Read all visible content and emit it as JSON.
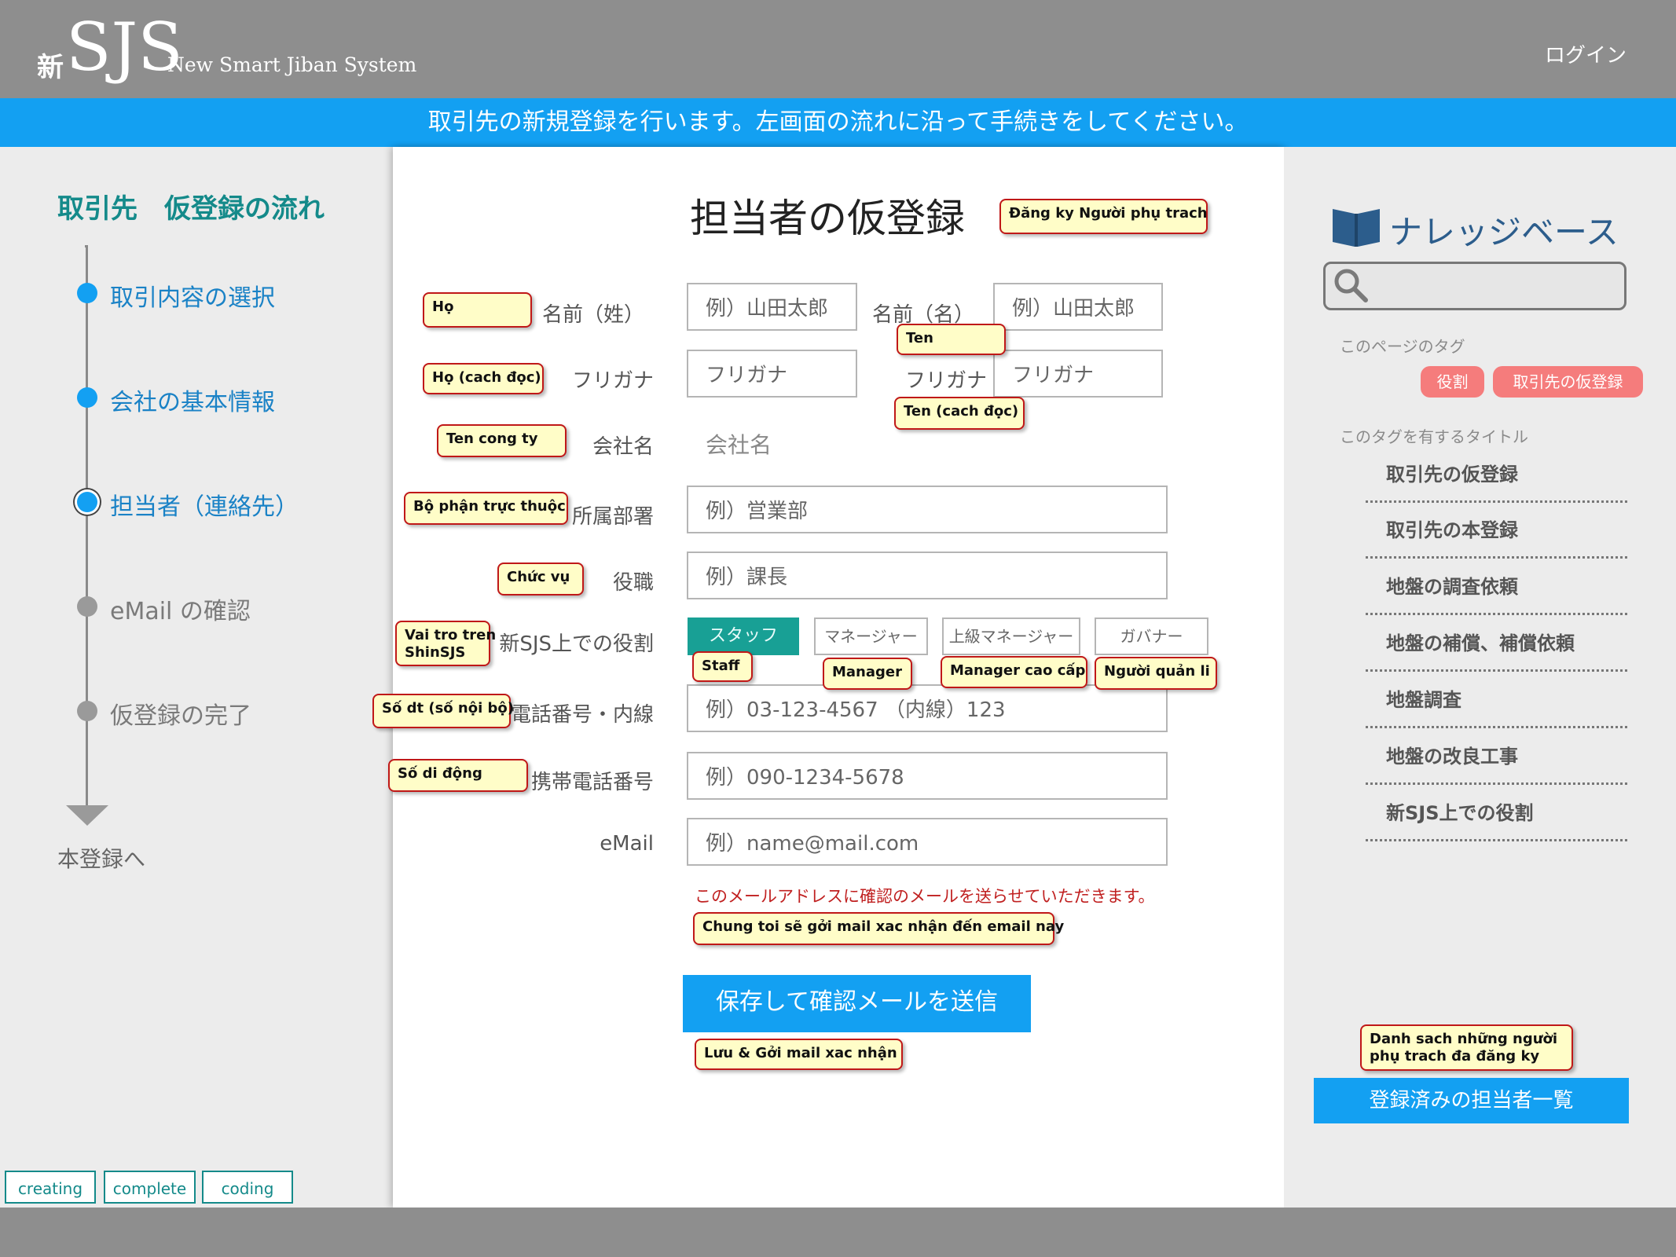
{
  "header": {
    "logo_kanji": "新",
    "logo_text": "SJS",
    "logo_subtitle": "New Smart Jiban System",
    "login_label": "ログイン"
  },
  "banner": {
    "text": "取引先の新規登録を行います。左画面の流れに沿って手続きをしてください。"
  },
  "flow": {
    "title": "取引先　仮登録の流れ",
    "steps": [
      {
        "label": "取引内容の選択",
        "state": "done"
      },
      {
        "label": "会社の基本情報",
        "state": "done"
      },
      {
        "label": "担当者（連絡先）",
        "state": "current"
      },
      {
        "label": "eMail の確認",
        "state": "todo"
      },
      {
        "label": "仮登録の完了",
        "state": "todo"
      }
    ],
    "end_label": "本登録へ"
  },
  "status_buttons": [
    "creating",
    "complete",
    "coding"
  ],
  "form": {
    "title": "担当者の仮登録",
    "last_name_label": "名前（姓）",
    "last_name_placeholder": "例）山田太郎",
    "first_name_label": "名前（名）",
    "first_name_placeholder": "例）山田太郎",
    "last_kana_label": "フリガナ",
    "last_kana_placeholder": "フリガナ",
    "first_kana_label": "フリガナ",
    "first_kana_placeholder": "フリガナ",
    "company_label": "会社名",
    "company_value": "会社名",
    "department_label": "所属部署",
    "department_placeholder": "例）営業部",
    "position_label": "役職",
    "position_placeholder": "例）課長",
    "role_label": "新SJS上での役割",
    "roles": [
      {
        "label": "スタッフ",
        "selected": true
      },
      {
        "label": "マネージャー",
        "selected": false
      },
      {
        "label": "上級マネージャー",
        "selected": false
      },
      {
        "label": "ガバナー",
        "selected": false
      }
    ],
    "phone_label": "電話番号・内線",
    "phone_placeholder": "例）03-123-4567 （内線）123",
    "mobile_label": "携帯電話番号",
    "mobile_placeholder": "例）090-1234-5678",
    "email_label": "eMail",
    "email_placeholder": "例）name@mail.com",
    "email_note": "このメールアドレスに確認のメールを送らせていただきます。",
    "submit_label": "保存して確認メールを送信"
  },
  "notes": {
    "title": "Đăng ky Người phụ trach",
    "last_name": "Họ",
    "last_kana": "Họ (cach đọc)",
    "first_name": "Ten",
    "first_kana": "Ten (cach đọc)",
    "company": "Ten cong ty",
    "department": "Bộ phận trực thuộc",
    "position": "Chức vụ",
    "role_line1": "Vai tro tren",
    "role_line2": "ShinSJS",
    "staff": "Staff",
    "manager": "Manager",
    "senior_manager": "Manager cao cấp",
    "governor": "Người quản li",
    "phone": "Số dt (số nội bộ)",
    "mobile": "Số di động",
    "email_note": "Chung toi sẽ gởi mail xac nhận đến email nay",
    "submit": "Lưu & Gởi mail xac nhận",
    "list_line1": "Danh sach những người",
    "list_line2": "phụ trach đa đăng ky"
  },
  "knowledge": {
    "title": "ナレッジベース",
    "search_placeholder": "",
    "tags_heading": "このページのタグ",
    "tags": [
      "役割",
      "取引先の仮登録"
    ],
    "titles_heading": "このタグを有するタイトル",
    "links": [
      "取引先の仮登録",
      "取引先の本登録",
      "地盤の調査依頼",
      "地盤の補償、補償依頼",
      "地盤調査",
      "地盤の改良工事",
      "新SJS上での役割"
    ],
    "list_button": "登録済みの担当者一覧"
  },
  "colors": {
    "accent": "#13a0f2",
    "teal": "#148a8a",
    "staff_selected": "#18a095",
    "tag": "#f57c7c",
    "note_border": "#c01818",
    "note_bg": "#fffdc8"
  }
}
